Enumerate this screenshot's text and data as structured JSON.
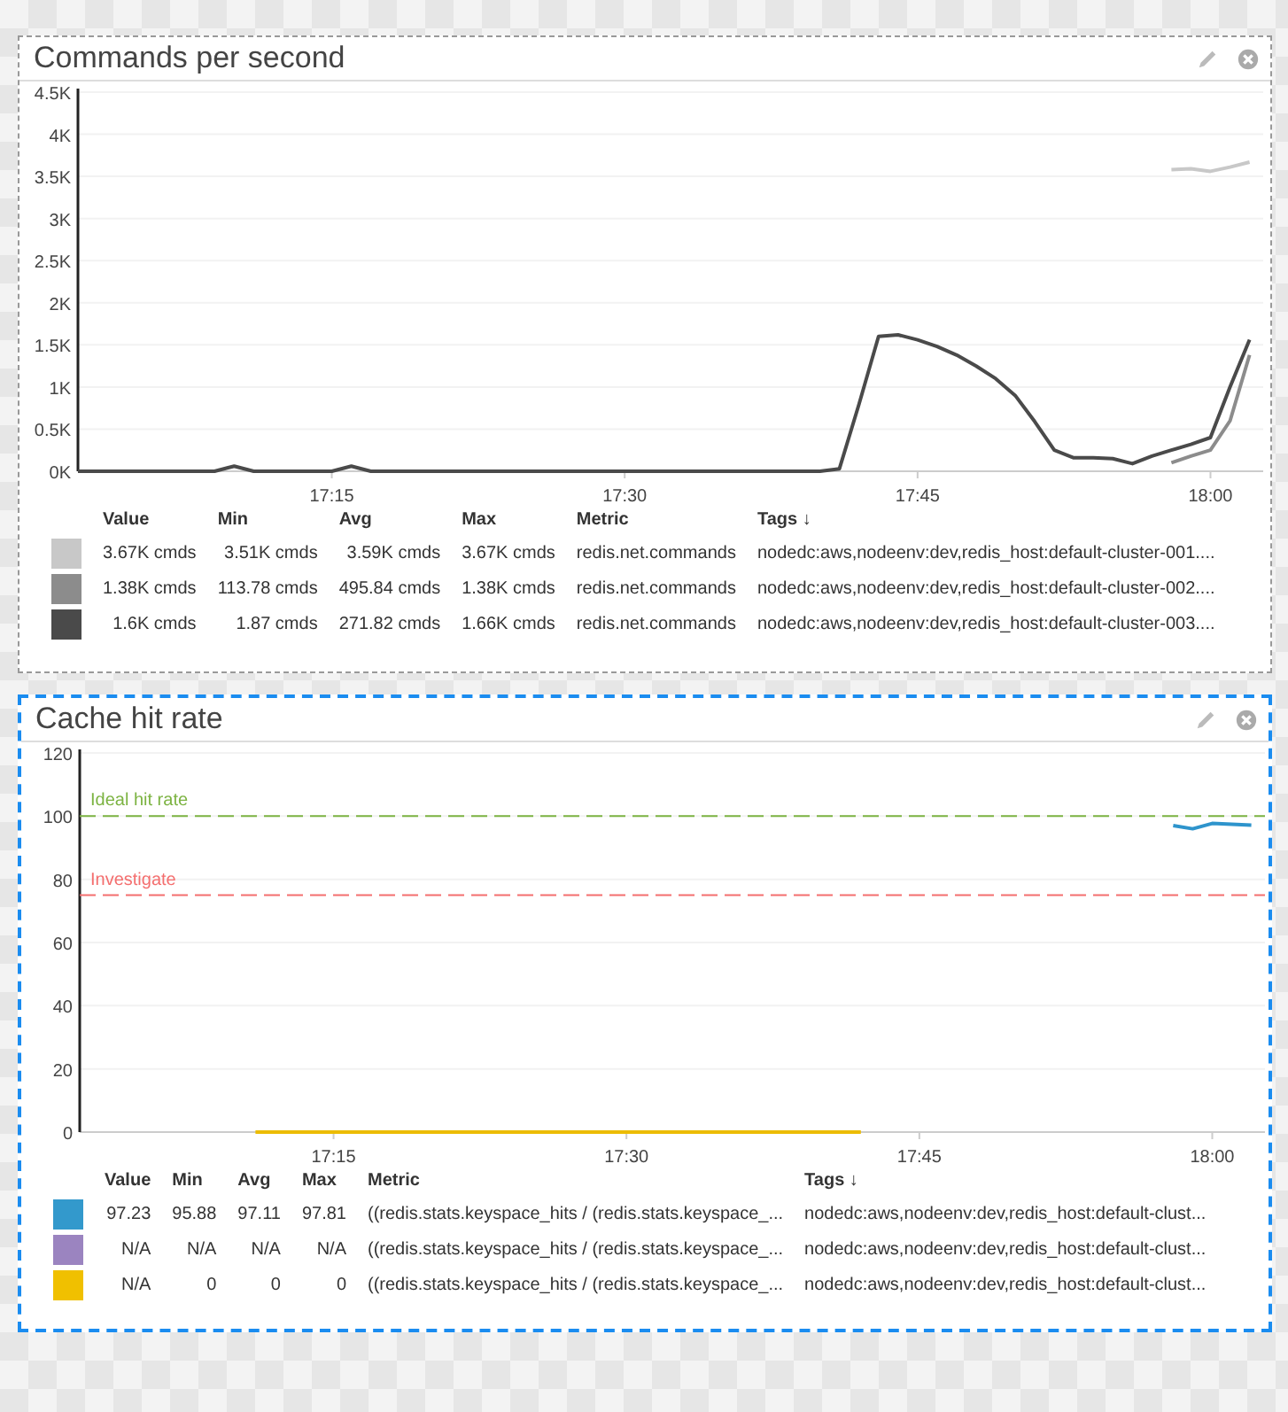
{
  "panels": [
    {
      "title": "Commands per second",
      "selected": false,
      "chart_data": {
        "type": "line",
        "categories": [
          null,
          null,
          null,
          null,
          null,
          null,
          null,
          null,
          null,
          null,
          null,
          null,
          null,
          "17:15",
          null,
          null,
          null,
          null,
          null,
          null,
          null,
          null,
          null,
          null,
          null,
          null,
          null,
          null,
          "17:30",
          null,
          null,
          null,
          null,
          null,
          null,
          null,
          null,
          null,
          null,
          null,
          null,
          null,
          null,
          "17:45",
          null,
          null,
          null,
          null,
          null,
          null,
          null,
          null,
          null,
          null,
          null,
          null,
          null,
          null,
          "18:00",
          null,
          null
        ],
        "series": [
          {
            "color": "#c8c8c8",
            "values": [
              null,
              null,
              null,
              null,
              null,
              null,
              null,
              null,
              null,
              null,
              null,
              null,
              null,
              null,
              null,
              null,
              null,
              null,
              null,
              null,
              null,
              null,
              null,
              null,
              null,
              null,
              null,
              null,
              null,
              null,
              null,
              null,
              null,
              null,
              null,
              null,
              null,
              null,
              null,
              null,
              null,
              null,
              null,
              null,
              null,
              null,
              null,
              null,
              null,
              null,
              null,
              null,
              null,
              null,
              null,
              null,
              3580,
              3590,
              3560,
              3610,
              3670
            ]
          },
          {
            "color": "#8c8c8c",
            "values": [
              null,
              null,
              null,
              null,
              null,
              null,
              null,
              null,
              null,
              null,
              null,
              null,
              null,
              null,
              null,
              null,
              null,
              null,
              null,
              null,
              null,
              null,
              null,
              null,
              null,
              null,
              null,
              null,
              null,
              null,
              null,
              null,
              null,
              null,
              null,
              null,
              null,
              null,
              null,
              null,
              null,
              null,
              null,
              null,
              null,
              null,
              null,
              null,
              null,
              null,
              null,
              null,
              null,
              null,
              null,
              null,
              100,
              180,
              250,
              600,
              1380
            ]
          },
          {
            "color": "#4a4a4a",
            "values": [
              0,
              0,
              0,
              0,
              0,
              0,
              0,
              0,
              60,
              0,
              0,
              0,
              0,
              0,
              60,
              0,
              0,
              0,
              0,
              0,
              0,
              0,
              0,
              0,
              0,
              0,
              0,
              0,
              0,
              0,
              0,
              0,
              0,
              0,
              0,
              0,
              0,
              0,
              0,
              30,
              800,
              1600,
              1620,
              1560,
              1480,
              1380,
              1250,
              1100,
              900,
              590,
              250,
              160,
              160,
              150,
              90,
              180,
              250,
              320,
              400,
              1000,
              1560
            ]
          }
        ],
        "ylim": [
          0,
          4500
        ],
        "grid": true,
        "yticks": [
          {
            "value": 0,
            "label": "0K"
          },
          {
            "value": 500,
            "label": "0.5K"
          },
          {
            "value": 1000,
            "label": "1K"
          },
          {
            "value": 1500,
            "label": "1.5K"
          },
          {
            "value": 2000,
            "label": "2K"
          },
          {
            "value": 2500,
            "label": "2.5K"
          },
          {
            "value": 3000,
            "label": "3K"
          },
          {
            "value": 3500,
            "label": "3.5K"
          },
          {
            "value": 4000,
            "label": "4K"
          },
          {
            "value": 4500,
            "label": "4.5K"
          }
        ]
      },
      "legend": {
        "columns": [
          "Value",
          "Min",
          "Avg",
          "Max",
          "Metric",
          "Tags ↓"
        ],
        "rows": [
          {
            "color": "#c8c8c8",
            "cells": [
              "3.67K cmds",
              "3.51K cmds",
              "3.59K cmds",
              "3.67K cmds",
              "redis.net.commands",
              "nodedc:aws,nodeenv:dev,redis_host:default-cluster-001...."
            ]
          },
          {
            "color": "#8c8c8c",
            "cells": [
              "1.38K cmds",
              "113.78 cmds",
              "495.84 cmds",
              "1.38K cmds",
              "redis.net.commands",
              "nodedc:aws,nodeenv:dev,redis_host:default-cluster-002...."
            ]
          },
          {
            "color": "#4a4a4a",
            "cells": [
              "1.6K cmds",
              "1.87 cmds",
              "271.82 cmds",
              "1.66K cmds",
              "redis.net.commands",
              "nodedc:aws,nodeenv:dev,redis_host:default-cluster-003...."
            ]
          }
        ]
      }
    },
    {
      "title": "Cache hit rate",
      "selected": true,
      "chart_data": {
        "type": "line",
        "categories": [
          null,
          null,
          null,
          null,
          null,
          null,
          null,
          null,
          null,
          null,
          null,
          null,
          null,
          "17:15",
          null,
          null,
          null,
          null,
          null,
          null,
          null,
          null,
          null,
          null,
          null,
          null,
          null,
          null,
          "17:30",
          null,
          null,
          null,
          null,
          null,
          null,
          null,
          null,
          null,
          null,
          null,
          null,
          null,
          null,
          "17:45",
          null,
          null,
          null,
          null,
          null,
          null,
          null,
          null,
          null,
          null,
          null,
          null,
          null,
          null,
          "18:00",
          null,
          null
        ],
        "series": [
          {
            "color": "#2e94cc",
            "values": [
              null,
              null,
              null,
              null,
              null,
              null,
              null,
              null,
              null,
              null,
              null,
              null,
              null,
              null,
              null,
              null,
              null,
              null,
              null,
              null,
              null,
              null,
              null,
              null,
              null,
              null,
              null,
              null,
              null,
              null,
              null,
              null,
              null,
              null,
              null,
              null,
              null,
              null,
              null,
              null,
              null,
              null,
              null,
              null,
              null,
              null,
              null,
              null,
              null,
              null,
              null,
              null,
              null,
              null,
              null,
              null,
              97,
              96,
              97.7,
              97.4,
              97.2
            ]
          },
          {
            "color": "#9680bf",
            "values": [
              null,
              null,
              null,
              null,
              null,
              null,
              null,
              null,
              null,
              null,
              null,
              null,
              null,
              null,
              null,
              null,
              null,
              null,
              null,
              null,
              null,
              null,
              null,
              null,
              null,
              null,
              null,
              null,
              null,
              null,
              null,
              null,
              null,
              null,
              null,
              null,
              null,
              null,
              null,
              null,
              null,
              null,
              null,
              null,
              null,
              null,
              null,
              null,
              null,
              null,
              null,
              null,
              null,
              null,
              null,
              null,
              null,
              null,
              null,
              null,
              null
            ]
          },
          {
            "color": "#ecbc00",
            "values": [
              null,
              null,
              null,
              null,
              null,
              null,
              null,
              null,
              null,
              0,
              0,
              0,
              0,
              0,
              0,
              0,
              0,
              0,
              0,
              0,
              0,
              0,
              0,
              0,
              0,
              0,
              0,
              0,
              0,
              0,
              0,
              0,
              0,
              0,
              0,
              0,
              0,
              0,
              0,
              0,
              0,
              null,
              null,
              null,
              null,
              null,
              null,
              null,
              null,
              null,
              null,
              null,
              null,
              null,
              null,
              null,
              null,
              null,
              null,
              null,
              null
            ]
          }
        ],
        "ylim": [
          0,
          120
        ],
        "yticks": [
          0,
          20,
          40,
          60,
          80,
          100,
          120
        ],
        "grid": true,
        "ref_lines": [
          {
            "axis": "y",
            "value": 100,
            "label": "Ideal hit rate",
            "color": "#7cb342"
          },
          {
            "axis": "y",
            "value": 75,
            "label": "Investigate",
            "color": "#f46e6e"
          }
        ]
      },
      "legend": {
        "columns": [
          "Value",
          "Min",
          "Avg",
          "Max",
          "Metric",
          "Tags ↓"
        ],
        "rows": [
          {
            "color": "#3399cc",
            "cells": [
              "97.23",
              "95.88",
              "97.11",
              "97.81",
              "((redis.stats.keyspace_hits / (redis.stats.keyspace_...",
              "nodedc:aws,nodeenv:dev,redis_host:default-clust..."
            ]
          },
          {
            "color": "#9b84c0",
            "cells": [
              "N/A",
              "N/A",
              "N/A",
              "N/A",
              "((redis.stats.keyspace_hits / (redis.stats.keyspace_...",
              "nodedc:aws,nodeenv:dev,redis_host:default-clust..."
            ]
          },
          {
            "color": "#f0c000",
            "cells": [
              "N/A",
              "0",
              "0",
              "0",
              "((redis.stats.keyspace_hits / (redis.stats.keyspace_...",
              "nodedc:aws,nodeenv:dev,redis_host:default-clust..."
            ]
          }
        ]
      }
    }
  ]
}
